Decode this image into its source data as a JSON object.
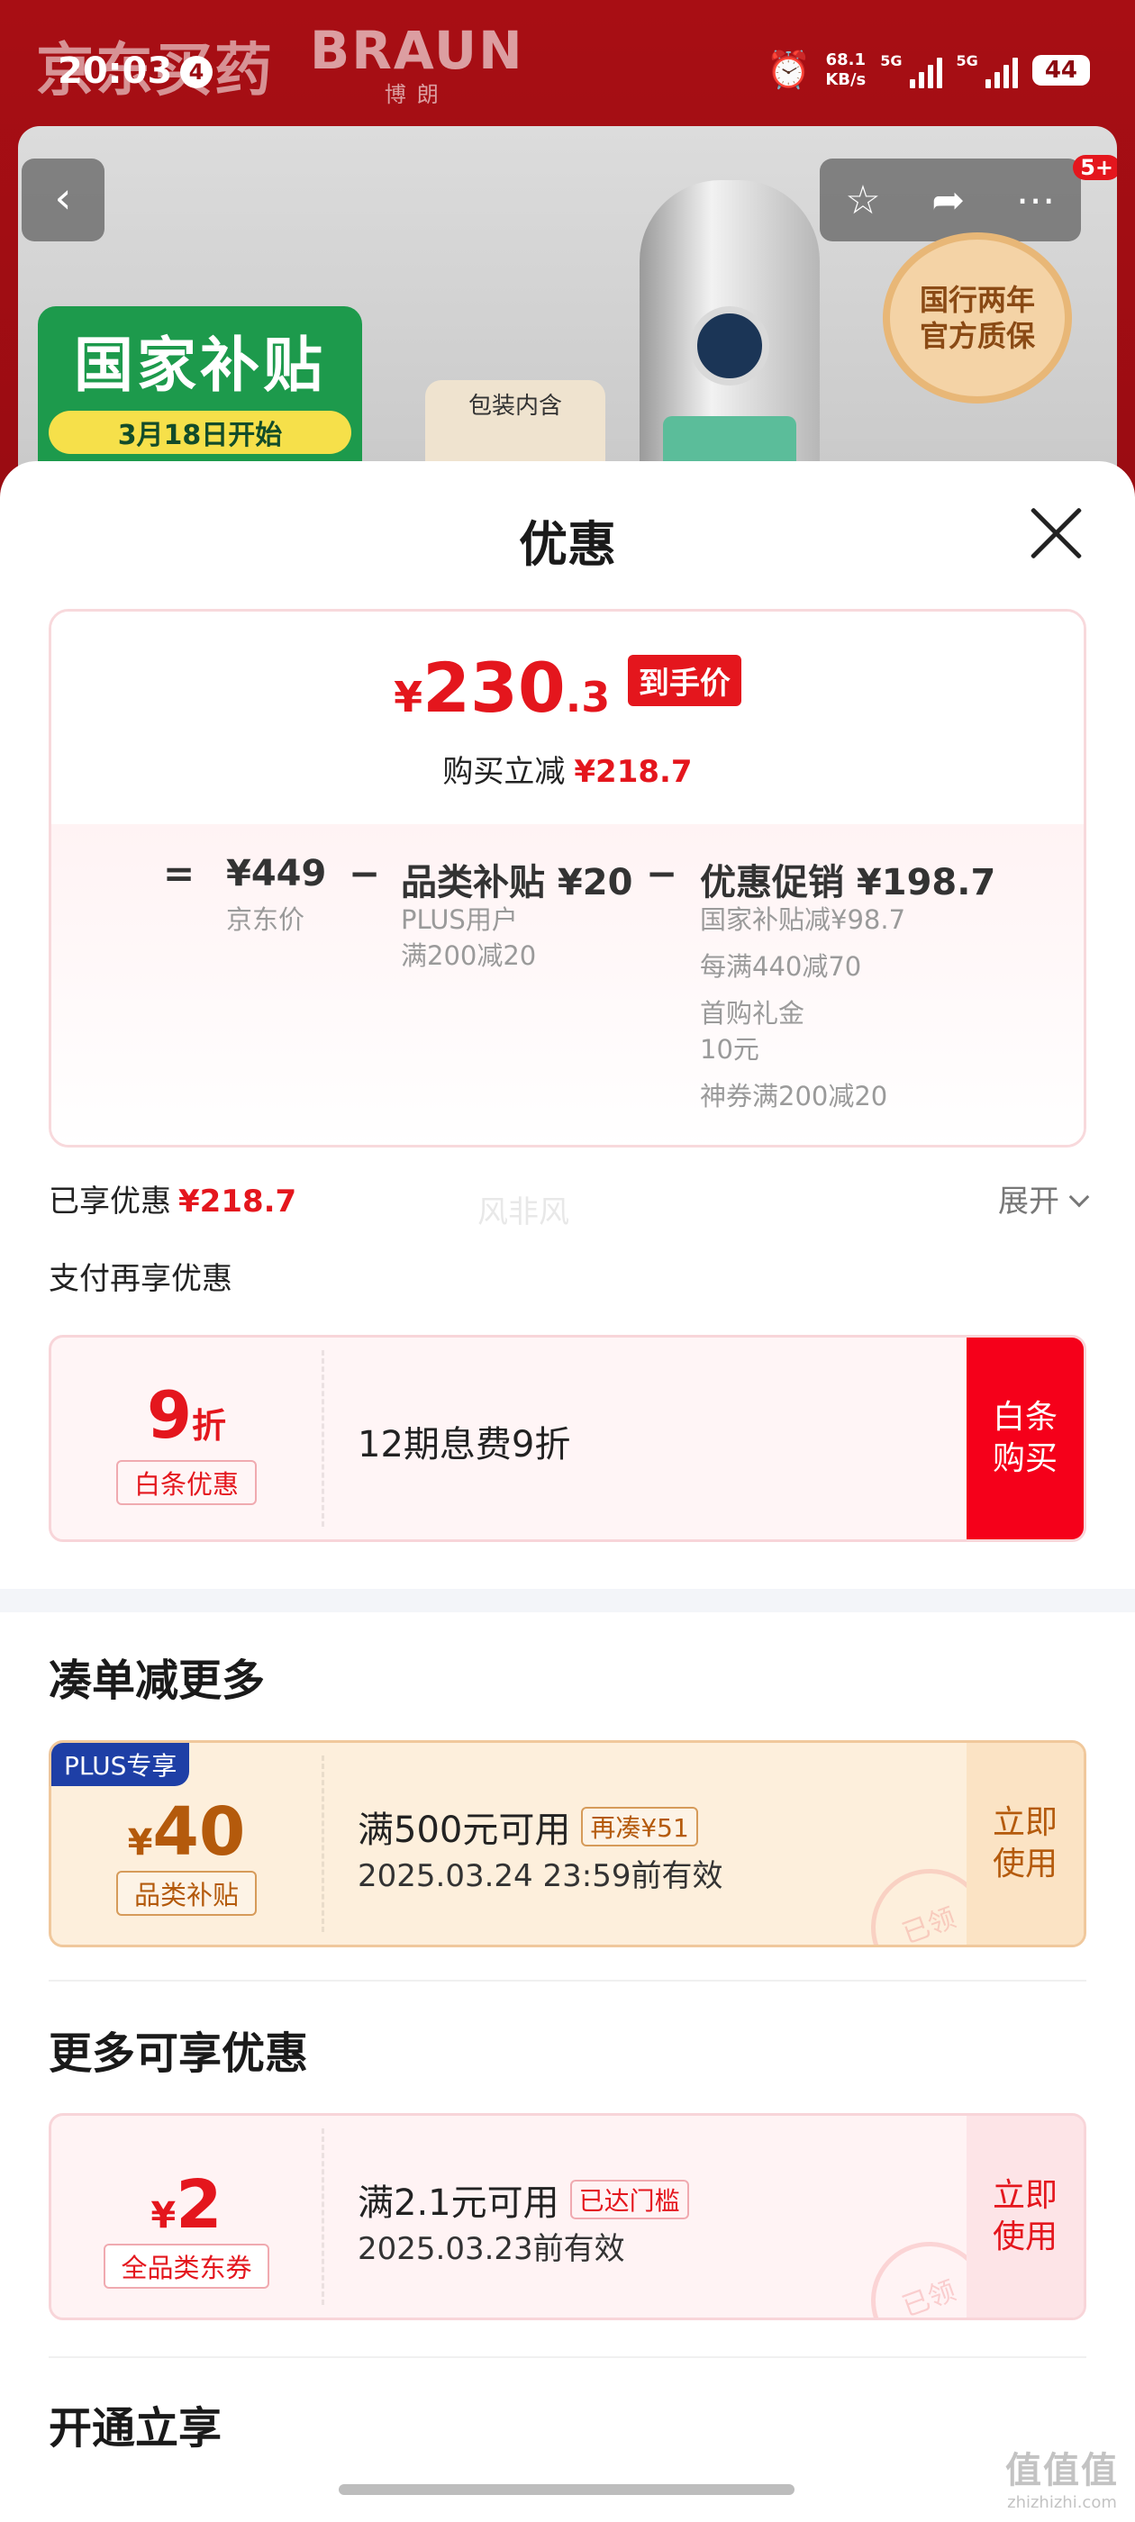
{
  "status_bar": {
    "time": "20:03",
    "notification_count": "4",
    "net_speed": "68.1",
    "net_unit": "KB/s",
    "sim1": "5G",
    "sim2": "5G",
    "battery": "44"
  },
  "header": {
    "store": "京东买药",
    "brand": "BRAUN",
    "brand_cn": "博朗",
    "more_badge": "5+"
  },
  "product": {
    "subsidy_title": "国家补贴",
    "subsidy_date": "3月18日开始",
    "package_label": "包装内含",
    "seal_text": "国行两年\n官方质保"
  },
  "sheet": {
    "title": "优惠",
    "final_price": {
      "yen": "¥",
      "integer": "230",
      "decimal": ".3",
      "tag": "到手价"
    },
    "instant_cut": {
      "label": "购买立减",
      "value": "¥218.7"
    },
    "calc": {
      "eq": "=",
      "minus": "−",
      "jd_price": "¥449",
      "jd_price_label": "京东价",
      "category_subsidy": "品类补贴 ¥20",
      "category_sub1": "PLUS用户",
      "category_sub2": "满200减20",
      "promo": "优惠促销 ¥198.7",
      "promo_items": [
        "国家补贴减¥98.7",
        "每满440减70",
        "首购礼金",
        "10元",
        "神券满200减20"
      ]
    },
    "enjoyed": {
      "label": "已享优惠",
      "value": "¥218.7",
      "expand": "展开"
    },
    "watermark_mid": "风非风",
    "pay_more": "支付再享优惠",
    "baitiao": {
      "discount": "9",
      "unit": "折",
      "tag": "白条优惠",
      "desc": "12期息费9折",
      "action": "白条\n购买"
    },
    "section1": "凑单减更多",
    "plus_coupon": {
      "badge": "PLUS专享",
      "yen": "¥",
      "amount": "40",
      "tag": "品类补贴",
      "condition": "满500元可用",
      "extra": "再凑¥51",
      "valid": "2025.03.24 23:59前有效",
      "action": "立即\n使用",
      "stamp": "已领"
    },
    "section2": "更多可享优惠",
    "all_coupon": {
      "yen": "¥",
      "amount": "2",
      "tag": "全品类东券",
      "condition": "满2.1元可用",
      "extra": "已达门槛",
      "valid": "2025.03.23前有效",
      "action": "立即\n使用",
      "stamp": "已领"
    },
    "section3": "开通立享"
  },
  "corner_watermark": {
    "main": "值值值",
    "url": "zhizhizhi.com"
  },
  "colors": {
    "accent_red": "#e4161d",
    "plus_blue": "#1e3fa6",
    "gold": "#b45a0c",
    "header_red": "#9a0c12"
  }
}
